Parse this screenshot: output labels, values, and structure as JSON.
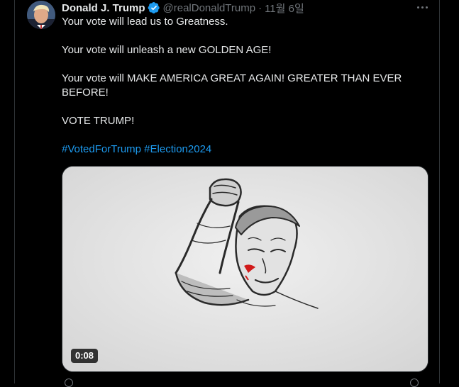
{
  "tweet": {
    "author": {
      "display_name": "Donald J. Trump",
      "handle": "@realDonaldTrump",
      "verified": true,
      "avatar_icon": "profile-photo"
    },
    "separator": "·",
    "date": "11월 6일",
    "more_icon": "ellipsis-icon",
    "text_lines": [
      "Your vote will lead us to Greatness.",
      "",
      "Your vote will unleash a new GOLDEN AGE!",
      "",
      "Your vote will MAKE AMERICA GREAT AGAIN! GREATER THAN EVER",
      "BEFORE!",
      "",
      "VOTE TRUMP!",
      ""
    ],
    "hashtags": [
      "#VotedForTrump",
      "#Election2024"
    ],
    "media": {
      "type": "video",
      "duration": "0:08",
      "description_icon": "sketch-illustration"
    }
  },
  "colors": {
    "background": "#000000",
    "text": "#e7e9ea",
    "secondary": "#71767b",
    "link": "#1d9bf0",
    "verified_badge": "#1d9bf0",
    "border": "#2f3336"
  }
}
